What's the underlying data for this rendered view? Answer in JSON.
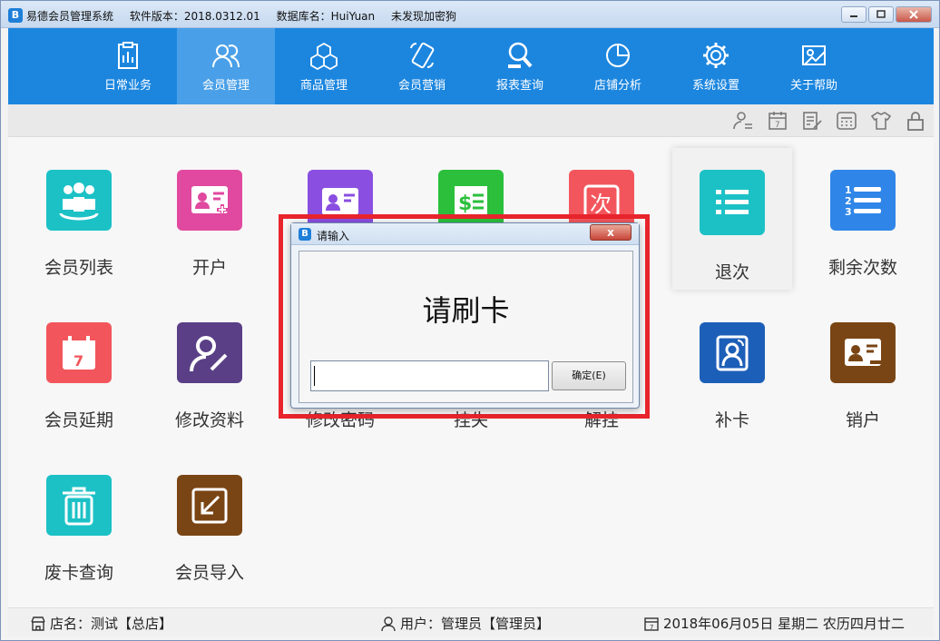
{
  "window": {
    "app_name": "易德会员管理系统",
    "version": "软件版本：2018.0312.01",
    "database": "数据库名：HuiYuan",
    "encryption": "未发现加密狗",
    "logo_letter": "B"
  },
  "nav": {
    "items": [
      {
        "label": "日常业务",
        "icon": "clipboard-icon"
      },
      {
        "label": "会员管理",
        "icon": "members-icon",
        "active": true
      },
      {
        "label": "商品管理",
        "icon": "cubes-icon"
      },
      {
        "label": "会员营销",
        "icon": "phone-marketing-icon"
      },
      {
        "label": "报表查询",
        "icon": "report-search-icon"
      },
      {
        "label": "店铺分析",
        "icon": "pie-chart-icon"
      },
      {
        "label": "系统设置",
        "icon": "gear-icon"
      },
      {
        "label": "关于帮助",
        "icon": "help-icon"
      }
    ]
  },
  "toolbar": {
    "icons": [
      "user-switch-icon",
      "calendar-icon",
      "edit-note-icon",
      "calculator-icon",
      "shirt-icon",
      "lock-icon"
    ]
  },
  "tiles": [
    {
      "label": "会员列表",
      "color": "#1cc1c6"
    },
    {
      "label": "开户",
      "color": "#e0499f"
    },
    {
      "label": "",
      "color": "#8a4fe0"
    },
    {
      "label": "",
      "color": "#2bbf3c"
    },
    {
      "label": "",
      "color": "#f2565c"
    },
    {
      "label": "退次",
      "color": "#1cc1c6"
    },
    {
      "label": "剩余次数",
      "color": "#2f86e8"
    },
    {
      "label": "会员延期",
      "color": "#f2565c"
    },
    {
      "label": "修改资料",
      "color": "#5a3f86"
    },
    {
      "label": "修改密码",
      "color": "#e8a23a"
    },
    {
      "label": "挂失",
      "color": "#e8a23a"
    },
    {
      "label": "解挂",
      "color": "#e8a23a"
    },
    {
      "label": "补卡",
      "color": "#1c5fb8"
    },
    {
      "label": "销户",
      "color": "#7a4514"
    },
    {
      "label": "废卡查询",
      "color": "#1cc1c6"
    },
    {
      "label": "会员导入",
      "color": "#7a4514"
    }
  ],
  "dialog": {
    "title": "请输入",
    "close_label": "x",
    "prompt": "请刷卡",
    "input_value": "",
    "ok_label": "确定(E)"
  },
  "status": {
    "store": "店名：测试【总店】",
    "user": "用户：管理员【管理员】",
    "date": "2018年06月05日 星期二 农历四月廿二"
  },
  "colors": {
    "nav_bg": "#1c86df",
    "nav_active": "#4aa0e8",
    "highlight": "#e8242c"
  }
}
